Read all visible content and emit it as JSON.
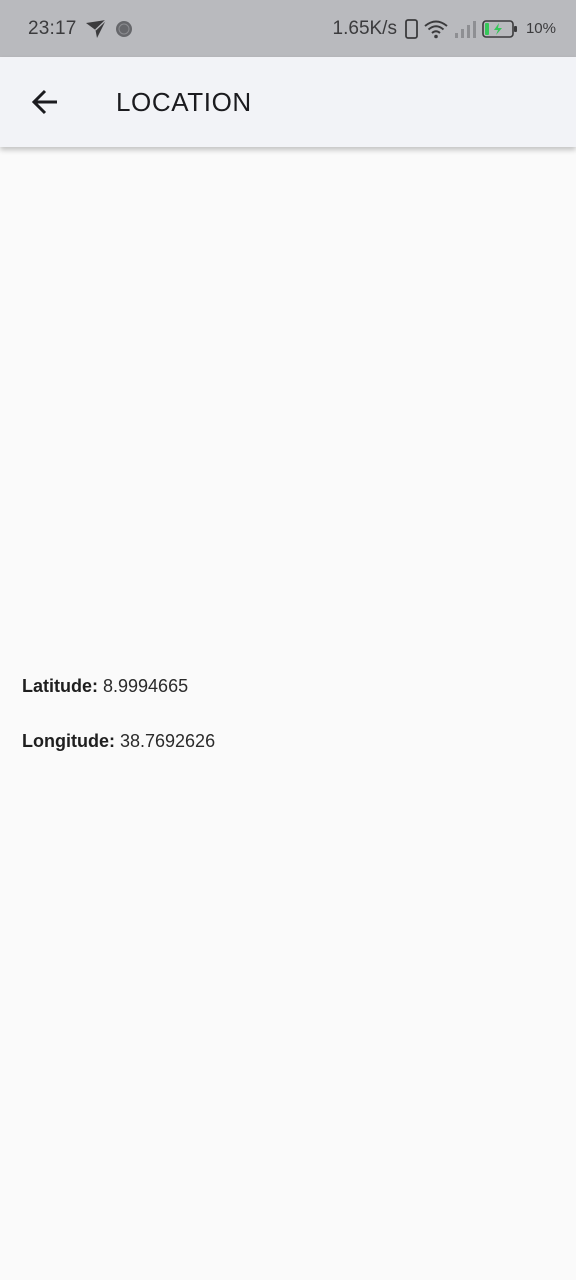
{
  "status_bar": {
    "time": "23:17",
    "network_speed": "1.65K/s",
    "battery_percent": "10%",
    "battery_level": 0.1,
    "icons": [
      "navigation-arrow-icon",
      "dot-icon",
      "phone-outline-icon",
      "wifi-icon",
      "signal-icon",
      "battery-charging-icon"
    ],
    "battery_color": "#35c759"
  },
  "app_bar": {
    "back_icon": "arrow-left-icon",
    "title": "LOCATION"
  },
  "location": {
    "latitude_label": "Latitude:",
    "latitude_value": "8.9994665",
    "longitude_label": "Longitude:",
    "longitude_value": "38.7692626"
  }
}
